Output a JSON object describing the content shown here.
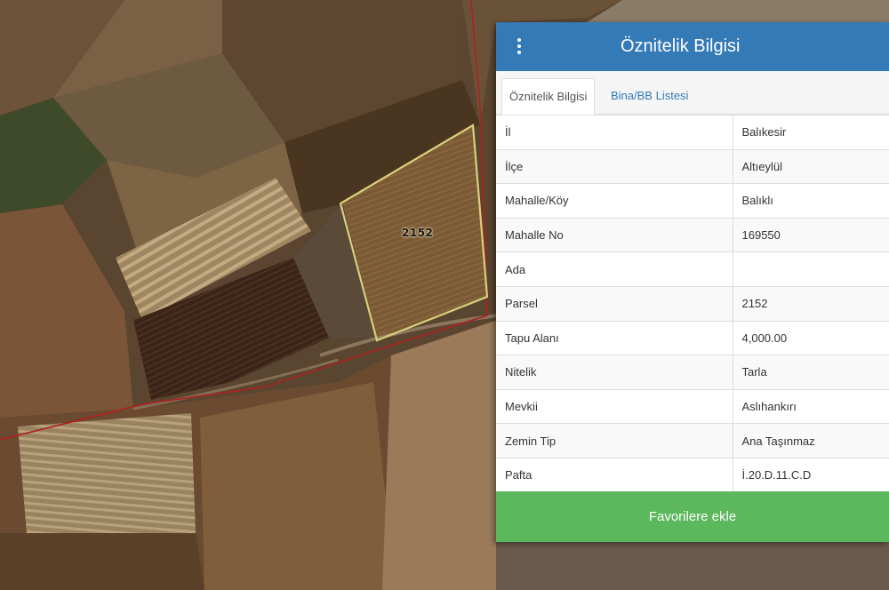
{
  "map": {
    "parcel_label": "2152"
  },
  "panel": {
    "menu_icon": "vertical-ellipsis-icon",
    "title": "Öznitelik Bilgisi",
    "tabs": [
      {
        "label": "Öznitelik Bilgisi",
        "active": true
      },
      {
        "label": "Bina/BB Listesi",
        "active": false
      }
    ],
    "rows": [
      {
        "key": "İl",
        "value": "Balıkesir"
      },
      {
        "key": "İlçe",
        "value": "Altıeylül"
      },
      {
        "key": "Mahalle/Köy",
        "value": "Balıklı"
      },
      {
        "key": "Mahalle No",
        "value": "169550"
      },
      {
        "key": "Ada",
        "value": ""
      },
      {
        "key": "Parsel",
        "value": "2152"
      },
      {
        "key": "Tapu Alanı",
        "value": "4,000.00"
      },
      {
        "key": "Nitelik",
        "value": "Tarla"
      },
      {
        "key": "Mevkii",
        "value": "Aslıhankırı"
      },
      {
        "key": "Zemin Tip",
        "value": "Ana Taşınmaz"
      },
      {
        "key": "Pafta",
        "value": "İ.20.D.11.C.D"
      }
    ],
    "favorite_button": "Favorilere ekle"
  },
  "colors": {
    "header": "#337ab7",
    "favorite_button": "#5cb85c",
    "parcel_outline": "#d8cf7a",
    "boundary_line": "#b0201e"
  }
}
